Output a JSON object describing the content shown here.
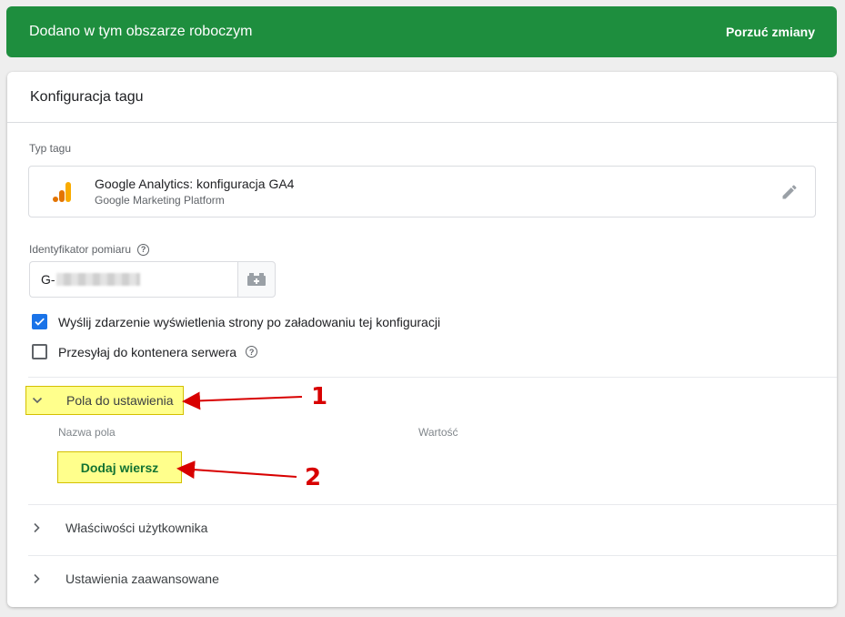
{
  "banner": {
    "title": "Dodano w tym obszarze roboczym",
    "action": "Porzuć zmiany"
  },
  "card": {
    "title": "Konfiguracja tagu",
    "tag_type": {
      "label": "Typ tagu",
      "name": "Google Analytics: konfiguracja GA4",
      "subtitle": "Google Marketing Platform",
      "icon": "google-analytics-icon"
    },
    "measurement_id": {
      "label": "Identyfikator pomiaru",
      "value_prefix": "G-"
    },
    "checkboxes": [
      {
        "label": "Wyślij zdarzenie wyświetlenia strony po załadowaniu tej konfiguracji",
        "checked": true
      },
      {
        "label": "Przesyłaj do kontenera serwera",
        "checked": false
      }
    ],
    "fields_section": {
      "label": "Pola do ustawienia",
      "col_name": "Nazwa pola",
      "col_value": "Wartość",
      "add_row": "Dodaj wiersz"
    },
    "user_properties": {
      "label": "Właściwości użytkownika"
    },
    "advanced": {
      "label": "Ustawienia zaawansowane"
    }
  },
  "annotations": [
    "1",
    "2"
  ],
  "colors": {
    "banner": "#1e8e3e",
    "accent": "#1a73e8",
    "highlight": "#ffff8c",
    "arrow": "#d80000"
  }
}
